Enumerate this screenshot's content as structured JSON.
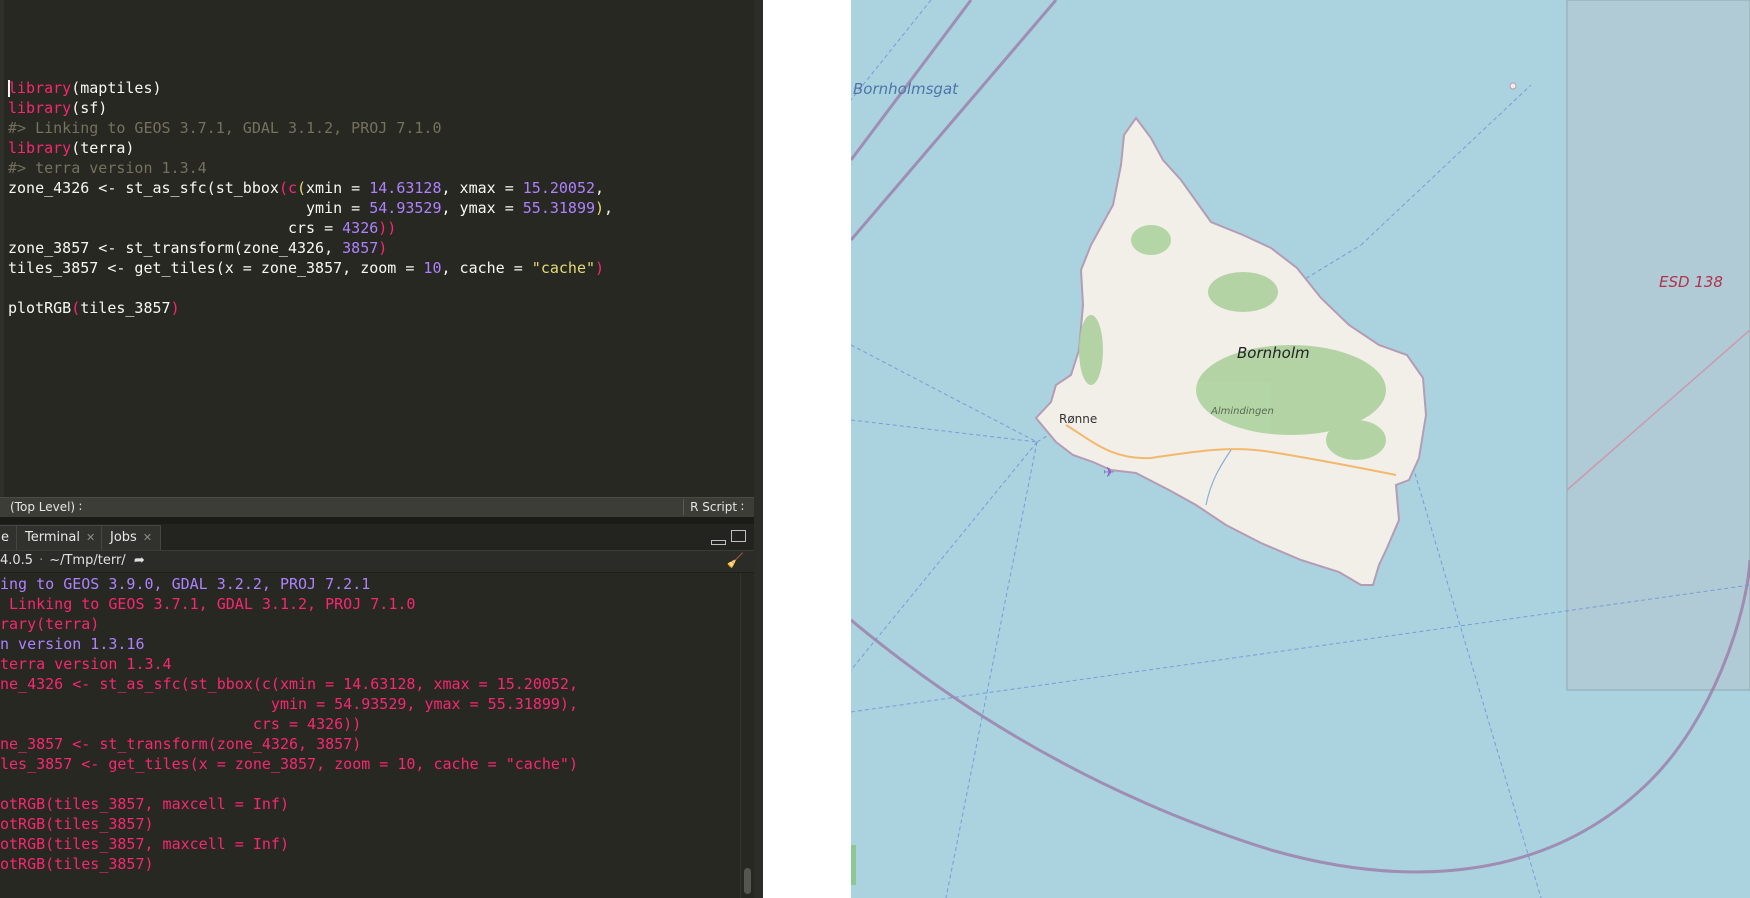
{
  "editor": {
    "code_lines": [
      [
        {
          "t": "library",
          "c": "fn"
        },
        {
          "t": "(",
          "c": "pn"
        },
        {
          "t": "maptiles",
          "c": "pn"
        },
        {
          "t": ")",
          "c": "pn"
        }
      ],
      [
        {
          "t": "library",
          "c": "fn"
        },
        {
          "t": "(sf)",
          "c": "pn"
        }
      ],
      [
        {
          "t": "#> Linking to GEOS 3.7.1, GDAL 3.1.2, PROJ 7.1.0",
          "c": "cm"
        }
      ],
      [
        {
          "t": "library",
          "c": "fn"
        },
        {
          "t": "(terra)",
          "c": "pn"
        }
      ],
      [
        {
          "t": "#> terra version 1.3.4",
          "c": "cm"
        }
      ],
      [
        {
          "t": "zone_4326 <- st_as_sfc(st_bbox",
          "c": "pn"
        },
        {
          "t": "(",
          "c": "fn"
        },
        {
          "t": "c",
          "c": "fn"
        },
        {
          "t": "(",
          "c": "st"
        },
        {
          "t": "xmin = ",
          "c": "pn"
        },
        {
          "t": "14.63128",
          "c": "nm"
        },
        {
          "t": ", xmax = ",
          "c": "pn"
        },
        {
          "t": "15.20052",
          "c": "nm"
        },
        {
          "t": ",",
          "c": "pn"
        }
      ],
      [
        {
          "t": "                                 ymin = ",
          "c": "pn"
        },
        {
          "t": "54.93529",
          "c": "nm"
        },
        {
          "t": ", ymax = ",
          "c": "pn"
        },
        {
          "t": "55.31899",
          "c": "nm"
        },
        {
          "t": ")",
          "c": "st"
        },
        {
          "t": ",",
          "c": "pn"
        }
      ],
      [
        {
          "t": "                               crs = ",
          "c": "pn"
        },
        {
          "t": "4326",
          "c": "nm"
        },
        {
          "t": "))",
          "c": "fn"
        }
      ],
      [
        {
          "t": "zone_3857 <- st_transform(zone_4326, ",
          "c": "pn"
        },
        {
          "t": "3857",
          "c": "nm"
        },
        {
          "t": ")",
          "c": "fn"
        }
      ],
      [
        {
          "t": "tiles_3857 <- get_tiles(x = zone_3857, zoom = ",
          "c": "pn"
        },
        {
          "t": "10",
          "c": "nm"
        },
        {
          "t": ", cache = ",
          "c": "pn"
        },
        {
          "t": "\"cache\"",
          "c": "st"
        },
        {
          "t": ")",
          "c": "fn"
        }
      ],
      [],
      [
        {
          "t": "plotRGB",
          "c": "pn"
        },
        {
          "t": "(",
          "c": "fn"
        },
        {
          "t": "tiles_3857",
          "c": "pn"
        },
        {
          "t": ")",
          "c": "fn"
        }
      ]
    ],
    "status": {
      "scope": "(Top Level) ∶",
      "file_type": "R Script ∶"
    }
  },
  "console_panel": {
    "tabs": [
      {
        "label": "e",
        "closable": false
      },
      {
        "label": "Terminal",
        "closable": true
      },
      {
        "label": "Jobs",
        "closable": true
      }
    ],
    "r_version": "4.0.5",
    "path": "~/Tmp/terr/",
    "lines": [
      {
        "t": "ing to GEOS 3.9.0, GDAL 3.2.2, PROJ 7.2.1",
        "c": "c-msg"
      },
      {
        "t": " Linking to GEOS 3.7.1, GDAL 3.1.2, PROJ 7.1.0",
        "c": "c-err"
      },
      {
        "t": "rary(terra)",
        "c": "c-err"
      },
      {
        "t": "n version 1.3.16",
        "c": "c-msg"
      },
      {
        "t": "terra version 1.3.4",
        "c": "c-err"
      },
      {
        "t": "ne_4326 <- st_as_sfc(st_bbox(c(xmin = 14.63128, xmax = 15.20052,",
        "c": "c-err"
      },
      {
        "t": "                              ymin = 54.93529, ymax = 55.31899),",
        "c": "c-err"
      },
      {
        "t": "                            crs = 4326))",
        "c": "c-err"
      },
      {
        "t": "ne_3857 <- st_transform(zone_4326, 3857)",
        "c": "c-err"
      },
      {
        "t": "les_3857 <- get_tiles(x = zone_3857, zoom = 10, cache = \"cache\")",
        "c": "c-err"
      },
      {
        "t": "",
        "c": "c-err"
      },
      {
        "t": "otRGB(tiles_3857, maxcell = Inf)",
        "c": "c-err"
      },
      {
        "t": "otRGB(tiles_3857)",
        "c": "c-err"
      },
      {
        "t": "otRGB(tiles_3857, maxcell = Inf)",
        "c": "c-err"
      },
      {
        "t": "otRGB(tiles_3857)",
        "c": "c-err"
      }
    ]
  },
  "plot": {
    "labels": {
      "strait": "Bornholmsgat",
      "island": "Bornholm",
      "town": "Rønne",
      "forest": "Almindingen",
      "zone": "ESD 138"
    },
    "colors": {
      "sea": "#aad3df",
      "land": "#f2efe9",
      "forest": "#add19e",
      "road": "#fcd6a4",
      "boundary": "#9b6fa0"
    }
  }
}
